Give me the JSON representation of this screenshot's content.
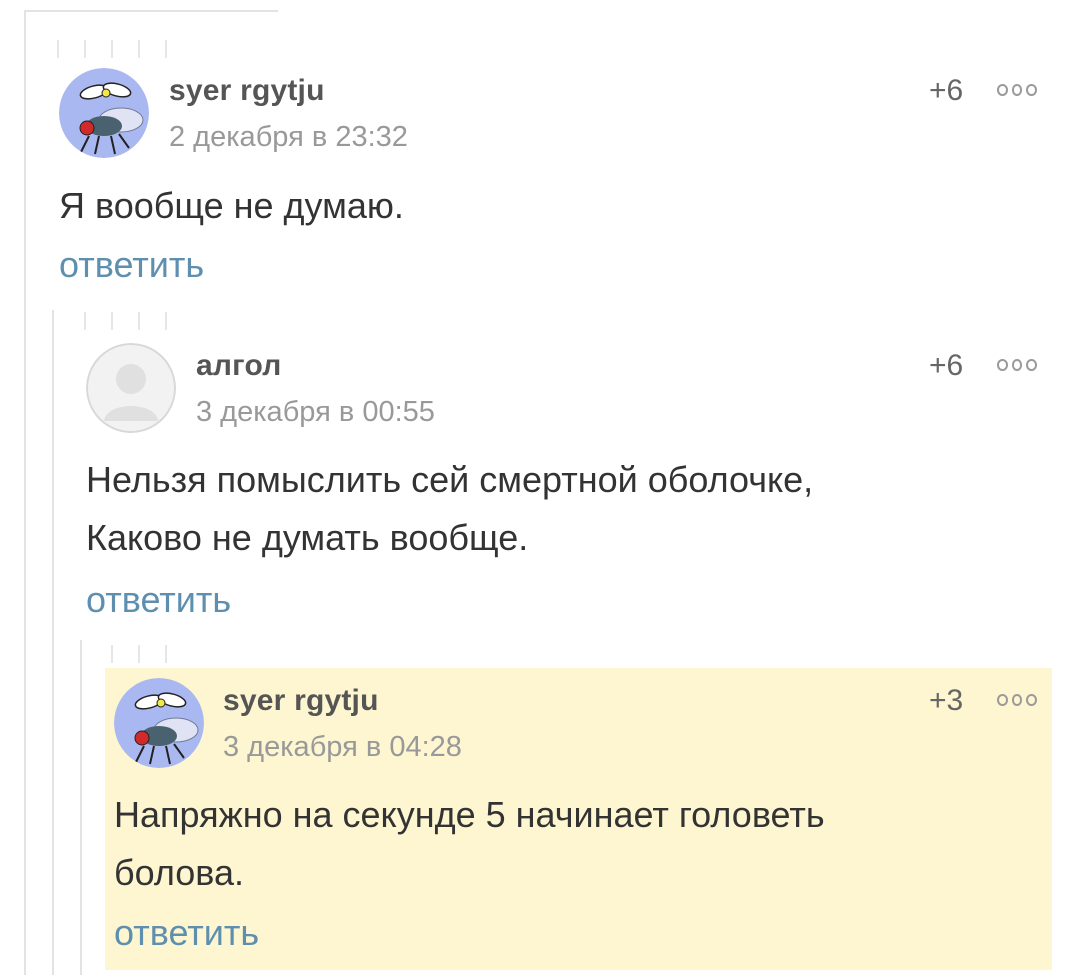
{
  "comments": [
    {
      "author": "syer rgytju",
      "date": "2 декабря в 23:32",
      "score": "+6",
      "text_lines": [
        "Я вообще не думаю."
      ],
      "reply_label": "ответить",
      "avatar_icon": "fly-avatar-icon"
    },
    {
      "author": "алгол",
      "date": "3 декабря в 00:55",
      "score": "+6",
      "text_lines": [
        "Нельзя помыслить сей смертной оболочке,",
        "Каково не думать вообще."
      ],
      "reply_label": "ответить",
      "avatar_icon": "default-user-avatar-icon"
    },
    {
      "author": "syer rgytju",
      "date": "3 декабря в 04:28",
      "score": "+3",
      "text_lines": [
        "Напряжно на секунде 5 начинает головеть",
        "болова."
      ],
      "reply_label": "ответить",
      "avatar_icon": "fly-avatar-icon",
      "highlighted": true
    }
  ],
  "colors": {
    "reply_link": "#5e8fae",
    "highlight_bg": "#fdf6d1",
    "avatar_bg": "#a9b8f0"
  }
}
